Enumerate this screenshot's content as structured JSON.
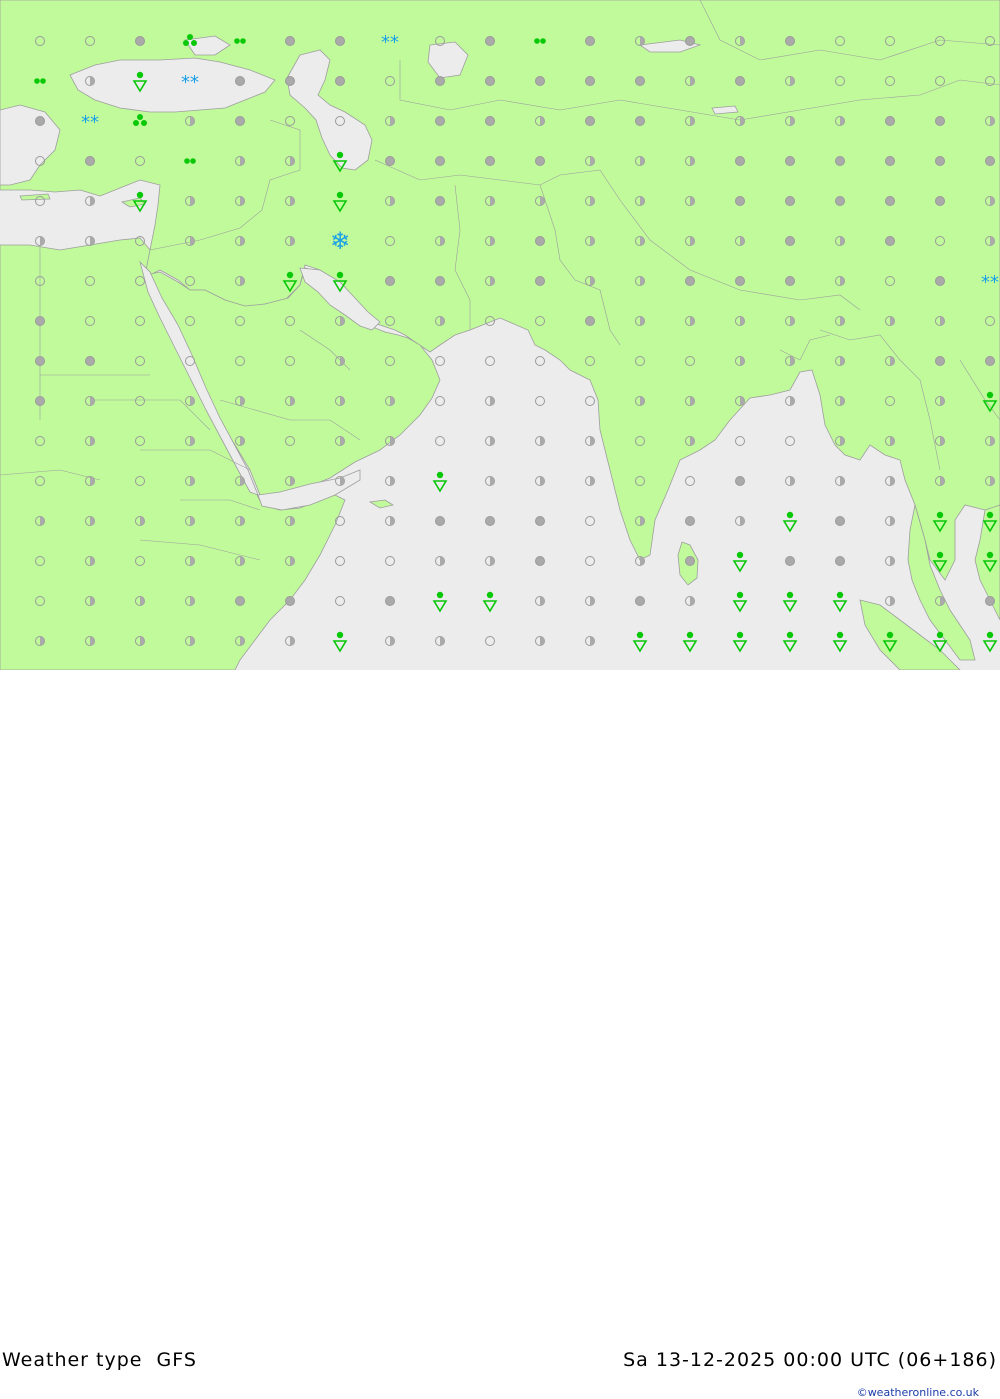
{
  "map": {
    "colors": {
      "sea": "#ececec",
      "land": "#c0fa9b",
      "border": "#9e9e9e",
      "dot_fill": "#aaaaaa",
      "dot_stroke": "#9a9a9a",
      "rain": "#08c808",
      "snow": "#1aa0e6"
    },
    "legend_symbols": [
      "overcast-dot",
      "half-cloud-dot",
      "clear-ring",
      "rain-shower-icon",
      "drizzle-icon",
      "rain-icon",
      "snow-icon",
      "heavy-snow-icon"
    ]
  },
  "footer": {
    "title": "Weather type  GFS",
    "datetime": "Sa 13-12-2025 00:00 UTC (06+186)",
    "credit": "©weatheronline.co.uk"
  }
}
